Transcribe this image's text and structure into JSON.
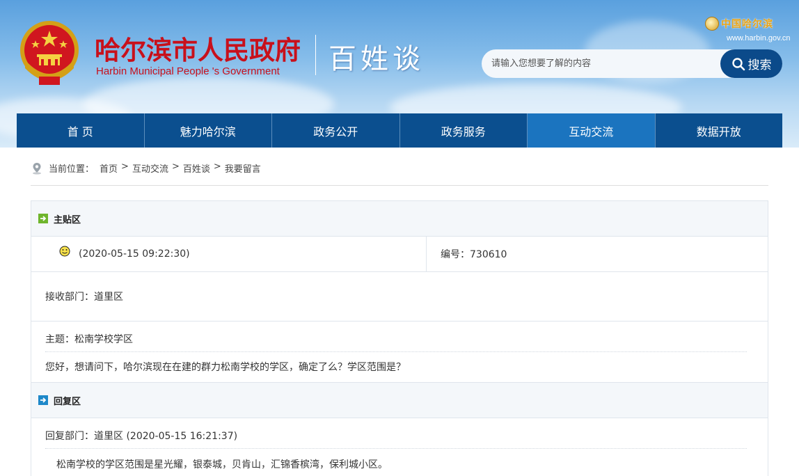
{
  "header": {
    "site_title": "哈尔滨市人民政府",
    "site_subtitle": "Harbin Municipal People 's Government",
    "column_title": "百姓谈",
    "corner_logo_text": "中国哈尔滨",
    "corner_url": "www.harbin.gov.cn",
    "emblem_icon": "national-emblem-icon",
    "search": {
      "placeholder": "请输入您想要了解的内容",
      "button_label": "搜索",
      "icon": "search-icon"
    }
  },
  "nav": {
    "items": [
      {
        "label": "首 页"
      },
      {
        "label": "魅力哈尔滨"
      },
      {
        "label": "政务公开"
      },
      {
        "label": "政务服务"
      },
      {
        "label": "互动交流",
        "active": true
      },
      {
        "label": "数据开放"
      }
    ],
    "colors": {
      "bar": "#0b4f8f",
      "active": "#1b74bf"
    }
  },
  "breadcrumb": {
    "prefix": "当前位置：",
    "items": [
      "首页",
      "互动交流",
      "百姓谈",
      "我要留言"
    ],
    "separator": ">",
    "icon": "location-pin-icon"
  },
  "main_post": {
    "section_title": "主贴区",
    "section_icon": "green-arrow-icon",
    "avatar_icon": "smiley-icon",
    "timestamp": "(2020-05-15 09:22:30)",
    "id_label": "编号：730610",
    "department": "接收部门：道里区",
    "subject": "主题：松南学校学区",
    "body": "您好，想请问下，哈尔滨现在在建的群力松南学校的学区，确定了么？学区范围是？"
  },
  "reply": {
    "section_title": "回复区",
    "section_icon": "blue-arrow-icon",
    "meta": "回复部门：道里区 (2020-05-15 16:21:37)",
    "body": "松南学校的学区范围是星光耀，银泰城，贝肯山，汇锦香槟湾，保利城小区。"
  },
  "colors": {
    "title_red": "#c8101b",
    "search_button": "#0b4a8a",
    "panel_border": "#dfe5ec",
    "panel_head_bg": "#f4f7fa"
  }
}
